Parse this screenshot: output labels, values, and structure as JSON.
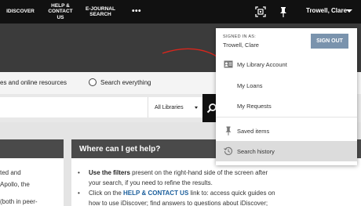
{
  "nav": {
    "idiscover": "IDISCOVER",
    "help": "HELP &\nCONTACT US",
    "ejournal": "E-JOURNAL\nSEARCH",
    "more": "•••"
  },
  "user": {
    "name": "Trowell, Clare"
  },
  "icons": {
    "qr": "qr-scan-icon",
    "pin": "pin-icon",
    "search": "search-icon",
    "account": "id-card-icon",
    "saved": "pin-icon",
    "history": "history-icon"
  },
  "search": {
    "option_partial": "es and online resources",
    "option_everything": "Search everything",
    "scope": "All Libraries"
  },
  "left_card_lines": [
    "ted and",
    "Apollo, the",
    "(both in peer-"
  ],
  "help": {
    "heading": "Where can I get help?",
    "bullet": "•",
    "line1_bold": "Use the filters",
    "line1_rest": " present on the right-hand side of the screen after",
    "line2": "your search, if you need to refine the results.",
    "line3_pre": "Click on the ",
    "line3_link": "HELP & CONTACT US",
    "line3_post": " link to: access quick guides on",
    "line4": "how to use iDiscover; find answers to questions about iDiscover;"
  },
  "dropdown": {
    "signed_in_label": "SIGNED IN AS:",
    "signed_in_name": "Trowell, Clare",
    "sign_out": "SIGN OUT",
    "items": [
      {
        "label": "My Library Account"
      },
      {
        "label": "My Loans"
      },
      {
        "label": "My Requests"
      },
      {
        "label": "Saved items"
      },
      {
        "label": "Search history"
      }
    ]
  },
  "colors": {
    "topbar": "#111111",
    "hero": "#3b3b3b",
    "signout": "#7a93ad",
    "annotation": "#d9261c",
    "link": "#1a5e9c"
  }
}
